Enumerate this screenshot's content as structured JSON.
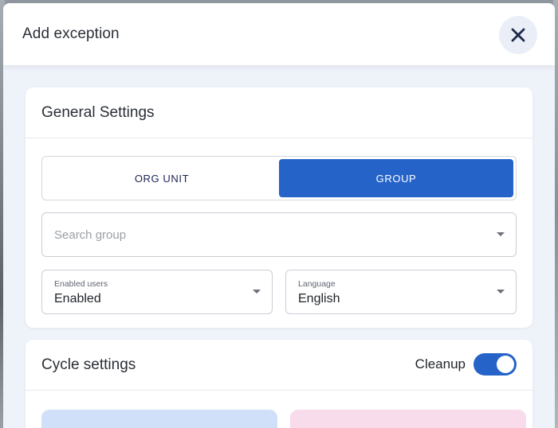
{
  "dialog": {
    "title": "Add exception",
    "close_icon": "close-icon"
  },
  "general": {
    "title": "General Settings",
    "segments": [
      {
        "label": "ORG UNIT",
        "active": false
      },
      {
        "label": "GROUP",
        "active": true
      }
    ],
    "search": {
      "placeholder": "Search group",
      "value": ""
    },
    "enabled_users": {
      "label": "Enabled users",
      "value": "Enabled"
    },
    "language": {
      "label": "Language",
      "value": "English"
    }
  },
  "cycle": {
    "title": "Cycle settings",
    "cleanup": {
      "label": "Cleanup",
      "enabled": true
    }
  },
  "colors": {
    "accent": "#2563c9",
    "dialog_bg": "#eef2f9",
    "tile_blue": "#cfe0f8",
    "tile_pink": "#f8dcec"
  }
}
